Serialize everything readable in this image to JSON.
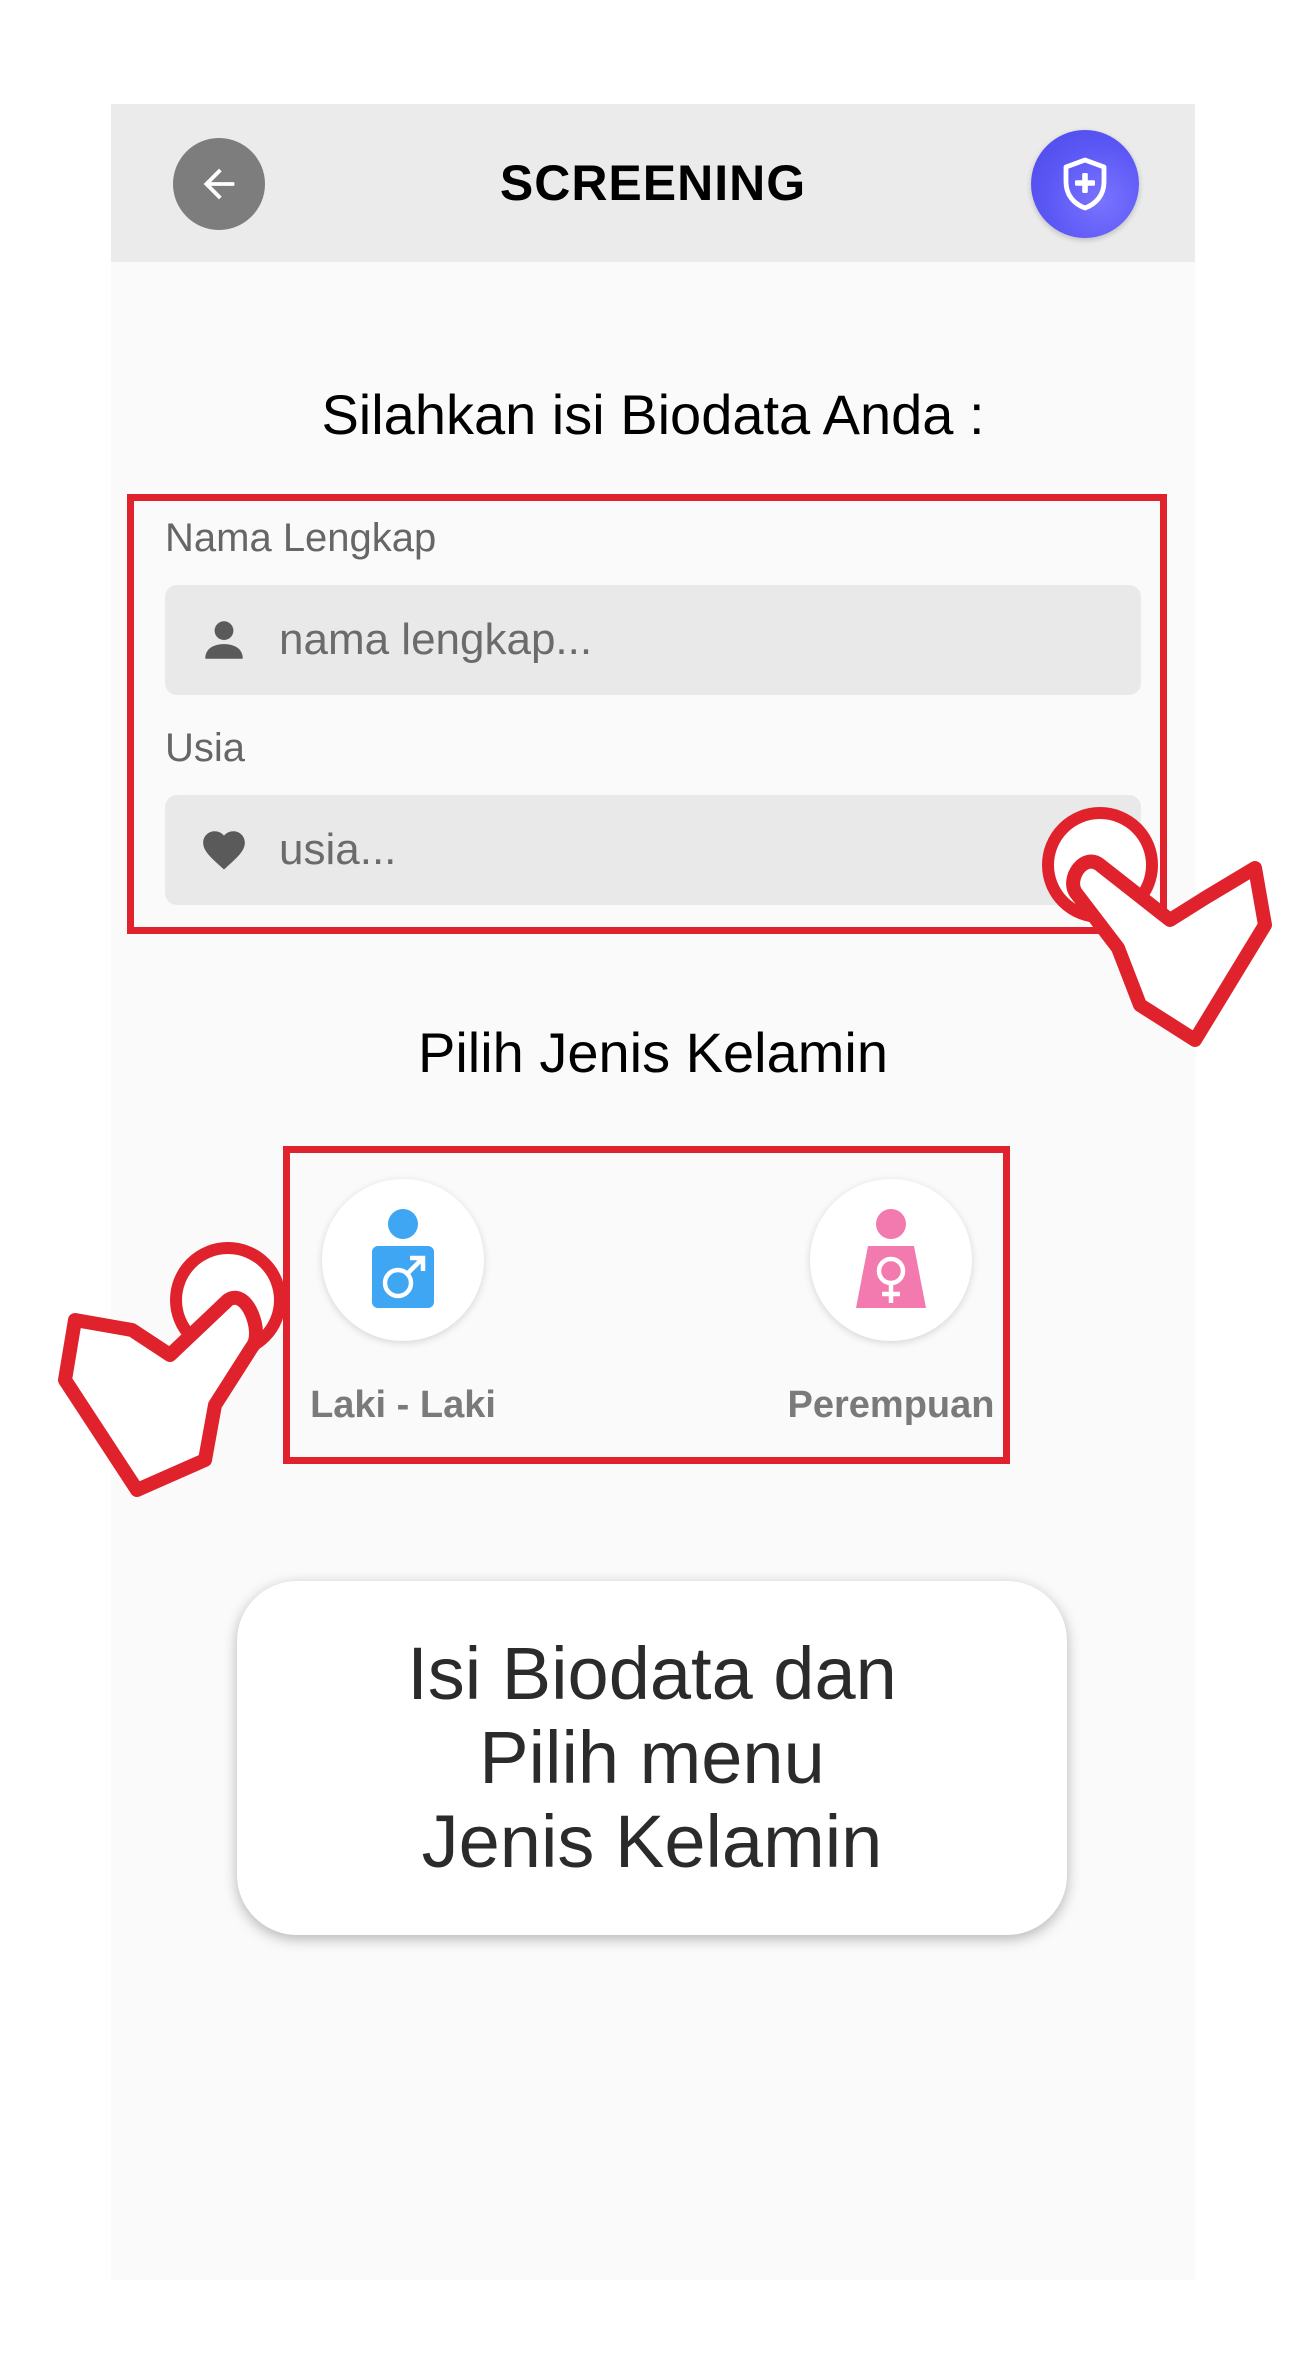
{
  "appbar": {
    "title": "SCREENING",
    "back_icon": "arrow-left-icon",
    "action_icon": "shield-plus-icon",
    "action_color": "#5b57f5"
  },
  "form": {
    "heading": "Silahkan isi Biodata Anda :",
    "name_label": "Nama Lengkap",
    "name_placeholder": "nama lengkap...",
    "name_icon": "person-icon",
    "age_label": "Usia",
    "age_placeholder": "usia...",
    "age_icon": "heart-icon"
  },
  "gender": {
    "title": "Pilih Jenis Kelamin",
    "male_label": "Laki - Laki",
    "female_label": "Perempuan",
    "male_color": "#3ea6f2",
    "female_color": "#f27aae"
  },
  "callout": {
    "line1": "Isi Biodata dan",
    "line2": "Pilih menu",
    "line3": "Jenis Kelamin"
  },
  "annotation_color": "#e0222d"
}
